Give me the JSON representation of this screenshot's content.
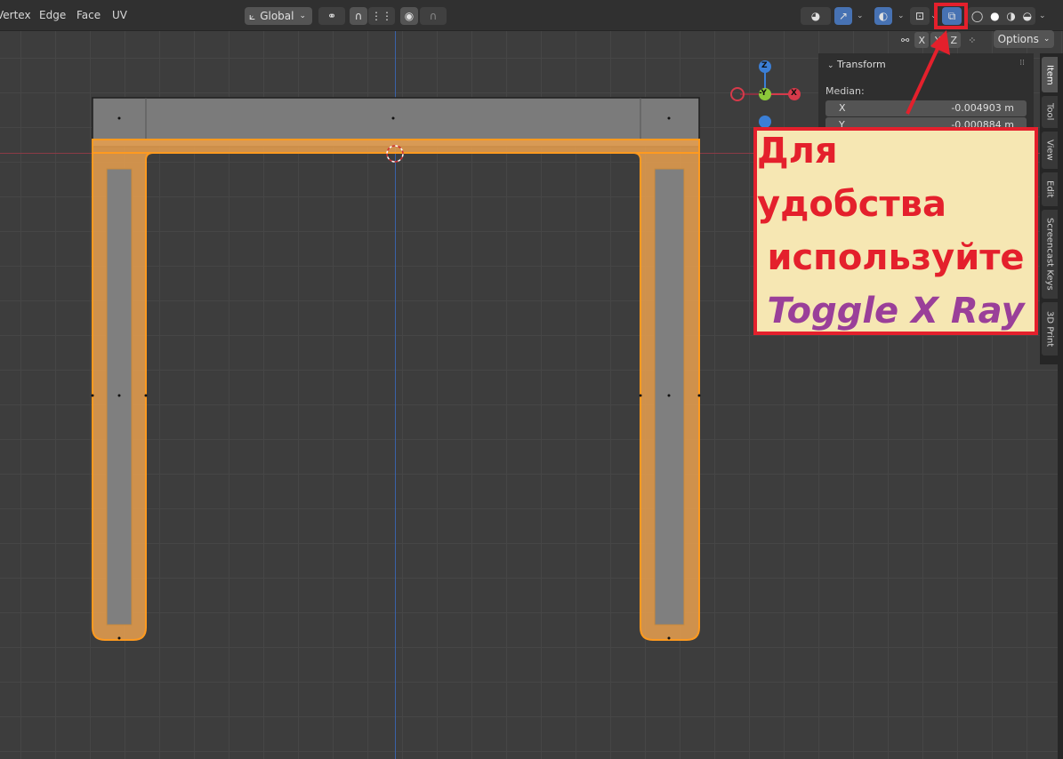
{
  "header": {
    "menu": [
      "Vertex",
      "Edge",
      "Face",
      "UV"
    ],
    "orientation": "Global"
  },
  "axes_row": {
    "x": "X",
    "y": "Y",
    "z": "Z",
    "options": "Options"
  },
  "gizmo": {
    "z": "Z",
    "y": "-Y",
    "x": "X"
  },
  "panel": {
    "title": "Transform",
    "median_label": "Median:",
    "fields": [
      {
        "label": "X",
        "value": "-0.004903 m"
      },
      {
        "label": "Y",
        "value": "-0.000884 m"
      }
    ]
  },
  "sidebar_tabs": [
    "Item",
    "Tool",
    "View",
    "Edit",
    "Screencast Keys",
    "3D Print"
  ],
  "annotation": {
    "line1": "Для удобства",
    "line2": "используйте",
    "line3": "Toggle X Ray"
  },
  "colors": {
    "accent_red": "#e4202c",
    "note_bg": "#f6e7b3",
    "note_purple": "#9a3f99",
    "selection_orange": "#ff9a1f",
    "button_active": "#4772b3"
  },
  "icons": [
    "transform-orientation-icon",
    "snap-icon",
    "proportional-edit-icon",
    "visibility-icon",
    "gizmo-icon",
    "overlay-icon",
    "mesh-select-icon",
    "xray-toggle-icon",
    "wireframe-shading-icon",
    "solid-shading-icon",
    "material-shading-icon",
    "rendered-shading-icon",
    "mirror-icon",
    "auto-merge-icon"
  ]
}
